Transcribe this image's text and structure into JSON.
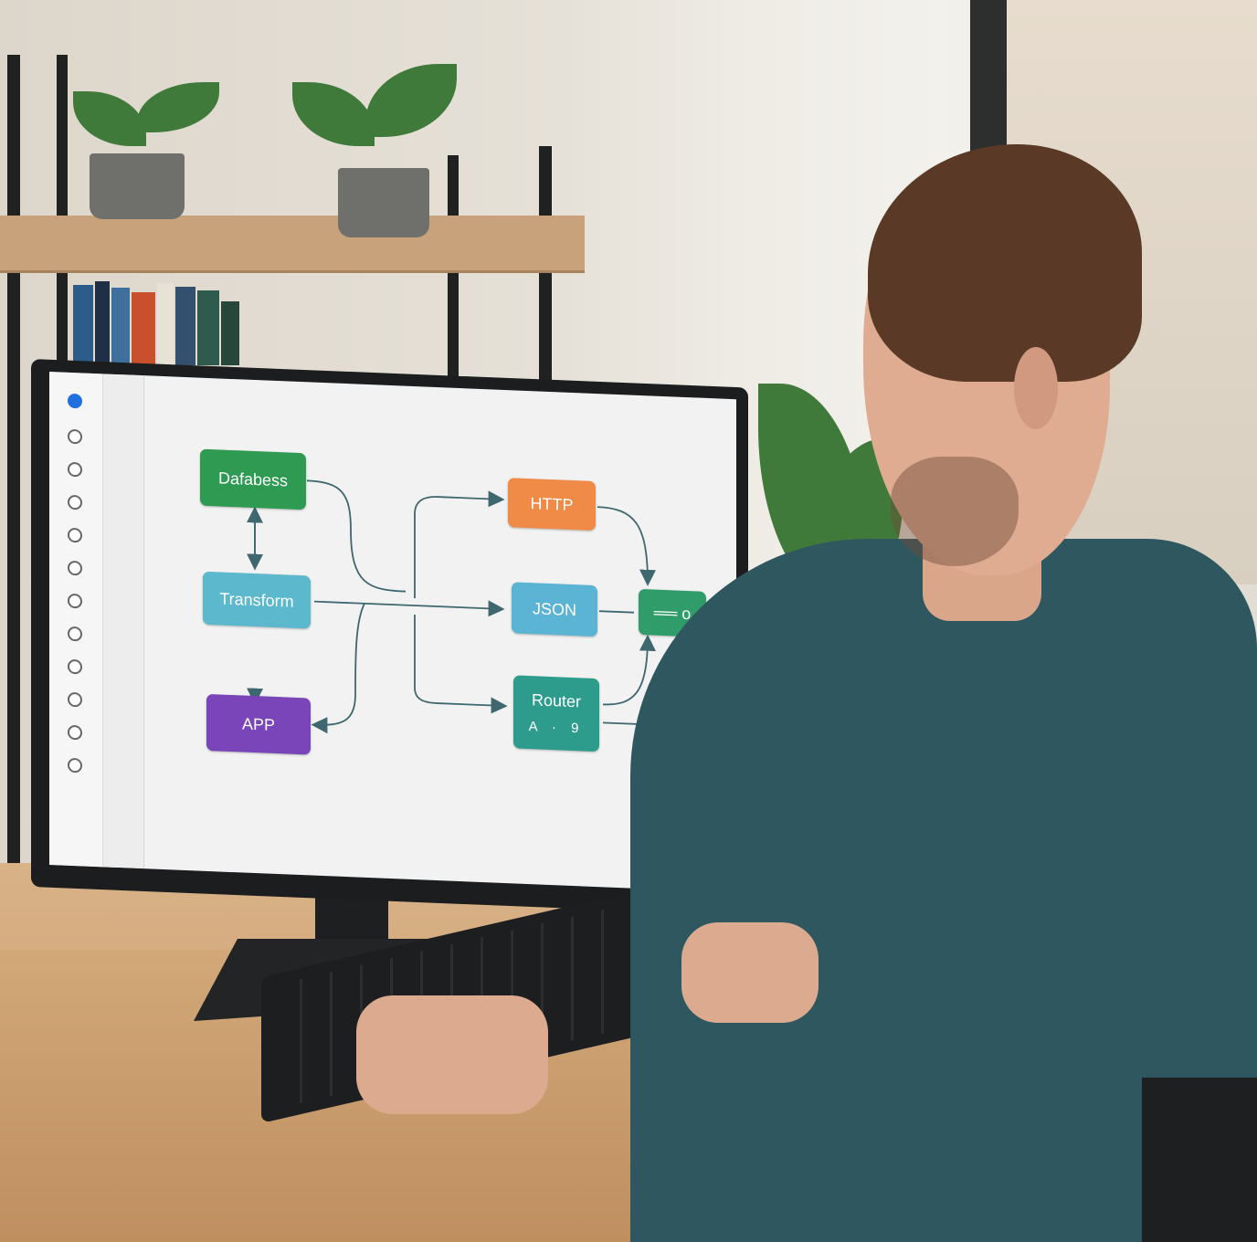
{
  "diagram": {
    "nodes": {
      "database": "Dafabess",
      "transform": "Transform",
      "app": "APP",
      "http": "HTTP",
      "json": "JSON",
      "router": "Router",
      "router_sub": "A · 9",
      "output": "══ o"
    }
  },
  "colors": {
    "database": "#2e9a52",
    "transform": "#5cb8cc",
    "app": "#7a45b8",
    "http": "#ef8a47",
    "json": "#5cb4d4",
    "router": "#2e9c8c",
    "output": "#2f9c6a",
    "edge": "#3e6770",
    "rail_active": "#1f6fe0"
  },
  "rail": {
    "items": [
      {
        "name": "step-1",
        "active": true
      },
      {
        "name": "step-2",
        "active": false
      },
      {
        "name": "step-3",
        "active": false
      },
      {
        "name": "step-4",
        "active": false
      },
      {
        "name": "step-5",
        "active": false
      },
      {
        "name": "step-6",
        "active": false
      },
      {
        "name": "step-7",
        "active": false
      },
      {
        "name": "step-8",
        "active": false
      },
      {
        "name": "step-9",
        "active": false
      },
      {
        "name": "step-10",
        "active": false
      },
      {
        "name": "step-11",
        "active": false
      },
      {
        "name": "step-12",
        "active": false
      }
    ]
  }
}
